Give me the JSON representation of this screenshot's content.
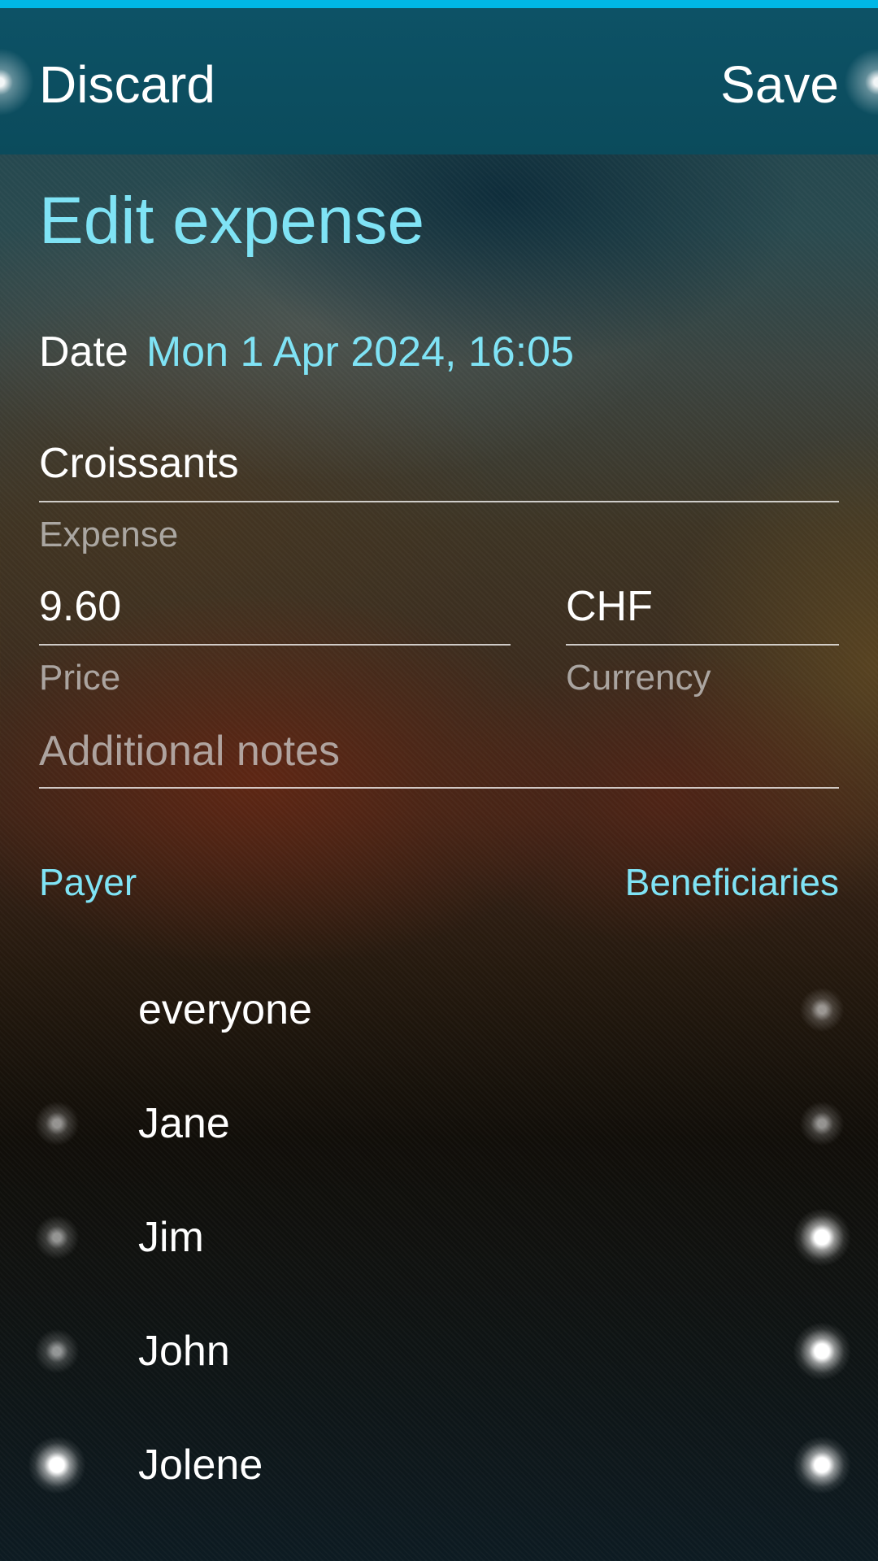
{
  "header": {
    "discard_label": "Discard",
    "save_label": "Save"
  },
  "page_title": "Edit expense",
  "date": {
    "label": "Date",
    "value": "Mon 1 Apr 2024, 16:05"
  },
  "expense": {
    "value": "Croissants",
    "label": "Expense"
  },
  "price": {
    "value": "9.60",
    "label": "Price"
  },
  "currency": {
    "value": "CHF",
    "label": "Currency"
  },
  "notes": {
    "placeholder": "Additional notes"
  },
  "sections": {
    "payer": "Payer",
    "beneficiaries": "Beneficiaries"
  },
  "people": [
    {
      "name": "everyone",
      "payer": null,
      "beneficiary": false
    },
    {
      "name": "Jane",
      "payer": false,
      "beneficiary": false
    },
    {
      "name": "Jim",
      "payer": false,
      "beneficiary": true
    },
    {
      "name": "John",
      "payer": false,
      "beneficiary": true
    },
    {
      "name": "Jolene",
      "payer": true,
      "beneficiary": true
    }
  ],
  "colors": {
    "accent": "#7fe3f5",
    "top_bar": "#00b7e6",
    "header_bg": "#0b4b5c"
  }
}
